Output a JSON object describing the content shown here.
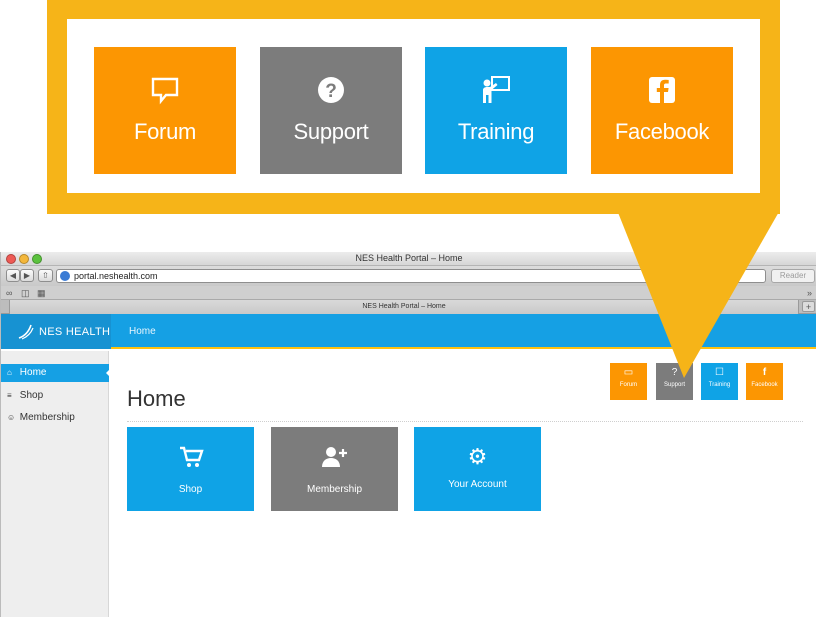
{
  "browser": {
    "window_title": "NES Health Portal – Home",
    "url": "portal.neshealth.com",
    "reader_label": "Reader",
    "tab_title": "NES Health Portal – Home",
    "new_tab_glyph": "+",
    "reload_glyph": "↻",
    "traffic_colors": [
      "#ee5a55",
      "#f3b73b",
      "#5bc23e"
    ]
  },
  "header": {
    "brand": "NES HEALTH",
    "nav_home": "Home"
  },
  "sidebar": {
    "items": [
      {
        "label": "Home",
        "icon": "home-icon",
        "glyph": "⌂",
        "active": true
      },
      {
        "label": "Shop",
        "icon": "cart-icon",
        "glyph": "≡",
        "active": false
      },
      {
        "label": "Membership",
        "icon": "add-user-icon",
        "glyph": "☺",
        "active": false
      }
    ]
  },
  "main": {
    "title": "Home",
    "quick_links": [
      {
        "label": "Forum",
        "icon": "speech-bubble-icon",
        "glyph": "▭",
        "color": "#fc9602"
      },
      {
        "label": "Support",
        "icon": "question-icon",
        "glyph": "?",
        "color": "#7c7c7c"
      },
      {
        "label": "Training",
        "icon": "presentation-icon",
        "glyph": "☐",
        "color": "#0fa3e6"
      },
      {
        "label": "Facebook",
        "icon": "facebook-icon",
        "glyph": "f",
        "color": "#fc9602"
      }
    ],
    "tiles": [
      {
        "label": "Shop",
        "icon": "cart-icon",
        "glyph": "☰",
        "color": "#0fa3e6"
      },
      {
        "label": "Membership",
        "icon": "add-user-icon",
        "glyph": "☺",
        "color": "#7c7c7c"
      },
      {
        "label": "Your Account",
        "icon": "gear-icon",
        "glyph": "⚙",
        "color": "#0fa3e6"
      }
    ]
  },
  "callout": {
    "color": "#f6b418",
    "tiles": [
      {
        "label": "Forum",
        "icon": "speech-bubble-icon",
        "color": "#fc9602"
      },
      {
        "label": "Support",
        "icon": "question-icon",
        "color": "#7c7c7c"
      },
      {
        "label": "Training",
        "icon": "presentation-icon",
        "color": "#0fa3e6"
      },
      {
        "label": "Facebook",
        "icon": "facebook-icon",
        "color": "#fc9602"
      }
    ]
  }
}
